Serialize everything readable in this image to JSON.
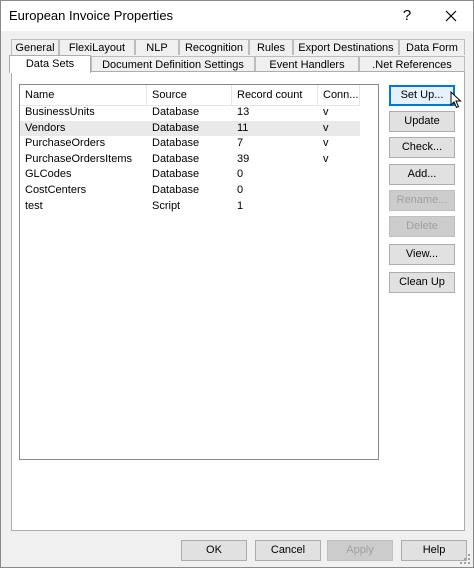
{
  "window": {
    "title": "European Invoice Properties",
    "help_glyph": "?"
  },
  "tabs_row1": [
    "General",
    "FlexiLayout",
    "NLP",
    "Recognition",
    "Rules",
    "Export Destinations",
    "Data Form"
  ],
  "tabs_row2": [
    "Data Sets",
    "Document Definition Settings",
    "Event Handlers",
    ".Net References"
  ],
  "active_tab": "Data Sets",
  "list": {
    "columns": [
      "Name",
      "Source",
      "Record count",
      "Conn..."
    ],
    "rows": [
      {
        "name": "BusinessUnits",
        "source": "Database",
        "count": "13",
        "conn": "v"
      },
      {
        "name": "Vendors",
        "source": "Database",
        "count": "11",
        "conn": "v"
      },
      {
        "name": "PurchaseOrders",
        "source": "Database",
        "count": "7",
        "conn": "v"
      },
      {
        "name": "PurchaseOrdersItems",
        "source": "Database",
        "count": "39",
        "conn": "v"
      },
      {
        "name": "GLCodes",
        "source": "Database",
        "count": "0",
        "conn": ""
      },
      {
        "name": "CostCenters",
        "source": "Database",
        "count": "0",
        "conn": ""
      },
      {
        "name": "test",
        "source": "Script",
        "count": "1",
        "conn": ""
      }
    ],
    "selected_row": 1
  },
  "side_buttons": {
    "setup": "Set Up...",
    "update": "Update",
    "check": "Check...",
    "add": "Add...",
    "rename": "Rename...",
    "delete": "Delete",
    "view": "View...",
    "cleanup": "Clean Up"
  },
  "bottom_buttons": {
    "ok": "OK",
    "cancel": "Cancel",
    "apply": "Apply",
    "help": "Help"
  }
}
